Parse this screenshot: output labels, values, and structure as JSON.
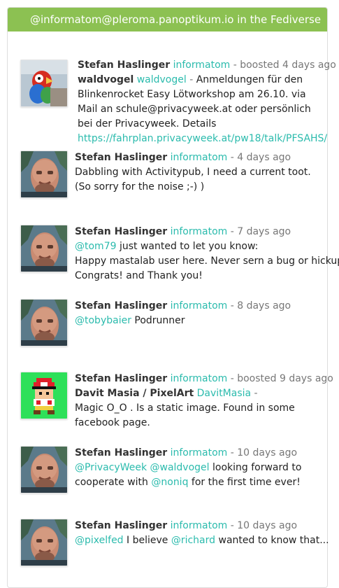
{
  "header": {
    "title": "@informatom@pleroma.panoptikum.io in the Fediverse"
  },
  "colors": {
    "header_bg": "#8cc152",
    "accent": "#2bbbad"
  },
  "toots": [
    {
      "author": "Stefan Haslinger",
      "handle": "informatom",
      "sep": " - ",
      "meta": "boosted 4 days ago",
      "boosted_author": "waldvogel",
      "boosted_handle": "waldvogel",
      "boosted_sep": " - ",
      "text": "Anmeldungen für den Blinkenrocket Easy Lötworkshop am 26.10. via Mail an schule@privacyweek.at oder persönlich bei der Privacyweek. Details",
      "link": "https://fahrplan.privacyweek.at/pw18/talk/PFSAHS/",
      "avatar_icon": "parrot-avatar-icon"
    },
    {
      "author": "Stefan Haslinger",
      "handle": "informatom",
      "sep": " - ",
      "meta": "4 days ago",
      "line1": "Dabbling with Activitypub, I need a current toot.",
      "line2": "(So sorry for the noise ;-) )",
      "avatar_icon": "user-photo-avatar-icon"
    },
    {
      "author": "Stefan Haslinger",
      "handle": "informatom",
      "sep": " - ",
      "meta": "7 days ago",
      "mention": "@tom79",
      "line1_rest": " just wanted to let you know:",
      "line2": "Happy mastalab user here. Never sern a bug or hickup.",
      "line3": "Congrats! and Thank you!",
      "avatar_icon": "user-photo-avatar-icon"
    },
    {
      "author": "Stefan Haslinger",
      "handle": "informatom",
      "sep": " - ",
      "meta": "8 days ago",
      "mention": "@tobybaier",
      "rest": " Podrunner",
      "avatar_icon": "user-photo-avatar-icon"
    },
    {
      "author": "Stefan Haslinger",
      "handle": "informatom",
      "sep": " - ",
      "meta": "boosted 9 days ago",
      "boosted_author": "Davit Masia / PixelArt",
      "boosted_handle": "DavitMasia",
      "boosted_sep": " -",
      "text": "Magic O_O . Is a static image. Found in some facebook page.",
      "avatar_icon": "pixel-art-avatar-icon"
    },
    {
      "author": "Stefan Haslinger",
      "handle": "informatom",
      "sep": " - ",
      "meta": "10 days ago",
      "mention1": "@PrivacyWeek",
      "mention2": "@waldvogel",
      "rest1": " looking forward to",
      "line2_start": "cooperate with ",
      "mention3": "@noniq",
      "rest2": " for the first time ever!",
      "avatar_icon": "user-photo-avatar-icon"
    },
    {
      "author": "Stefan Haslinger",
      "handle": "informatom",
      "sep": " - ",
      "meta": "10 days ago",
      "mention1": "@pixelfed",
      "rest1": " I believe ",
      "mention2": "@richard",
      "rest2": " wanted to know that...",
      "avatar_icon": "user-photo-avatar-icon"
    }
  ]
}
